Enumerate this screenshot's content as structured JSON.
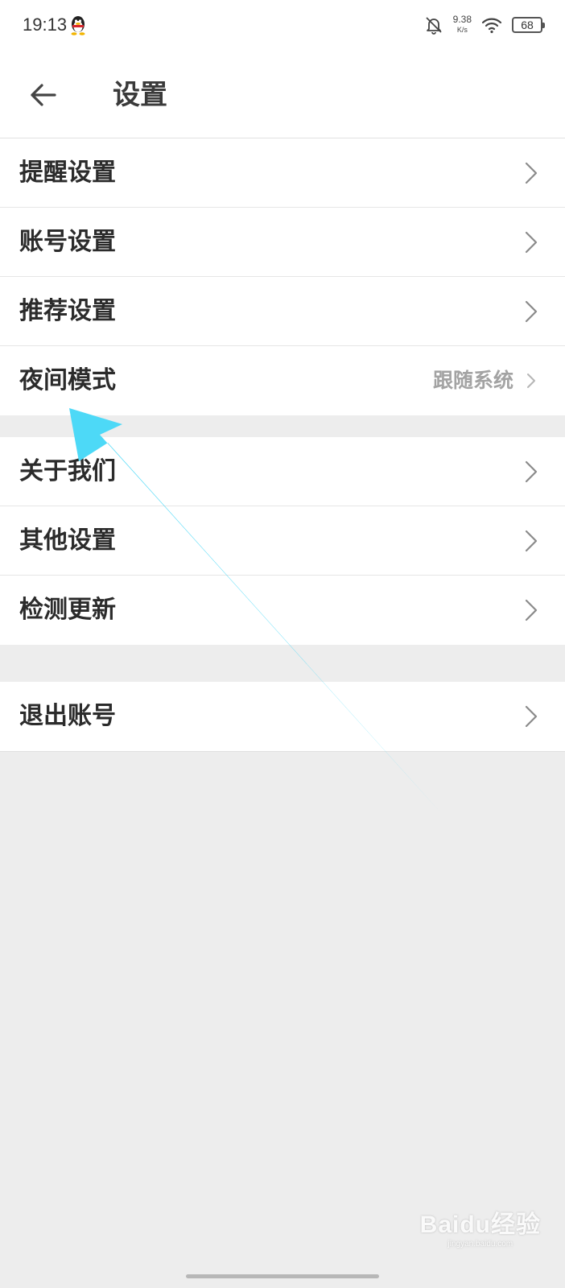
{
  "status_bar": {
    "time": "19:13",
    "net_speed_value": "9.38",
    "net_speed_unit": "K/s",
    "battery": "68"
  },
  "header": {
    "title": "设置"
  },
  "groups": [
    {
      "items": [
        {
          "label": "提醒设置"
        },
        {
          "label": "账号设置"
        },
        {
          "label": "推荐设置"
        },
        {
          "label": "夜间模式",
          "value": "跟随系统"
        }
      ]
    },
    {
      "items": [
        {
          "label": "关于我们"
        },
        {
          "label": "其他设置"
        },
        {
          "label": "检测更新"
        }
      ]
    },
    {
      "items": [
        {
          "label": "退出账号"
        }
      ]
    }
  ],
  "watermark": {
    "logo": "Baidu经验",
    "sub": "jingyan.baidu.com"
  },
  "colors": {
    "annotation_arrow": "#4dd9f7",
    "background": "#ededed"
  }
}
